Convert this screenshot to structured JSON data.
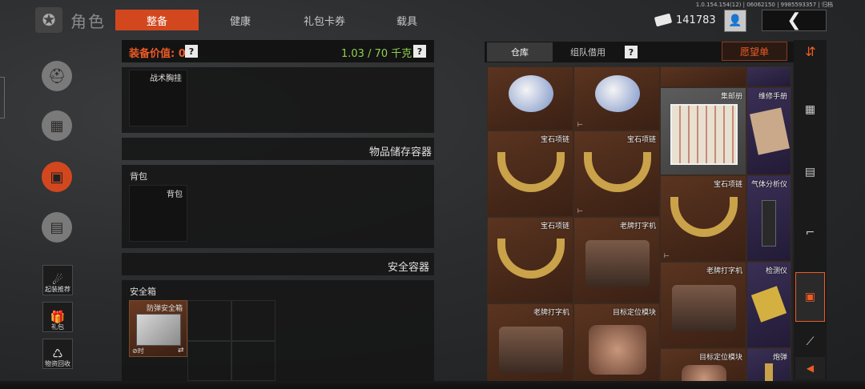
{
  "version": "1.0.154.154(12) | 06062150 | 9985593357 | 归档",
  "header": {
    "title": "角色",
    "tabs": [
      {
        "label": "整备",
        "active": true
      },
      {
        "label": "健康",
        "active": false
      },
      {
        "label": "礼包卡券",
        "active": false
      },
      {
        "label": "载具",
        "active": false
      }
    ],
    "currency": "141783",
    "back_icon": "❮"
  },
  "left_rail": {
    "labels": [
      "起装推荐",
      "礼包",
      "物资回收"
    ]
  },
  "equipment": {
    "value_label": "装备价值: 0",
    "weight": "1.03 / 70 千克",
    "help": "?",
    "vest_label": "战术胸挂",
    "storage_title": "物品储存容器",
    "backpack_section": "背包",
    "backpack_slot": "背包",
    "safe_title": "安全容器",
    "safe_section": "安全箱",
    "safe_item": "防弹安全箱",
    "safe_item_tag": "⊘时",
    "safe_item_swap": "⇄"
  },
  "inventory": {
    "tabs": [
      {
        "label": "仓库",
        "active": true
      },
      {
        "label": "组队借用",
        "active": false
      }
    ],
    "help": "?",
    "wishlist": "愿望单",
    "items": [
      {
        "name": "",
        "tag": "",
        "color": "brown"
      },
      {
        "name": "",
        "tag": "⊢",
        "color": "brown"
      },
      {
        "name": "集邮册",
        "tag": "",
        "color": "gray"
      },
      {
        "name": "维修手册",
        "tag": "",
        "color": "purple"
      },
      {
        "name": "宝石项链",
        "tag": "",
        "color": "brown"
      },
      {
        "name": "宝石项链",
        "tag": "⊢",
        "color": "brown"
      },
      {
        "name": "宝石项链",
        "tag": "⊢",
        "color": "brown"
      },
      {
        "name": "气体分析仪",
        "tag": "",
        "color": "purple"
      },
      {
        "name": "宝石项链",
        "tag": "",
        "color": "brown"
      },
      {
        "name": "老牌打字机",
        "tag": "",
        "color": "brown"
      },
      {
        "name": "老牌打字机",
        "tag": "",
        "color": "brown"
      },
      {
        "name": "检测仪",
        "tag": "",
        "color": "purple"
      },
      {
        "name": "老牌打字机",
        "tag": "",
        "color": "brown"
      },
      {
        "name": "目标定位模块",
        "tag": "",
        "color": "brown"
      },
      {
        "name": "目标定位模块",
        "tag": "",
        "color": "brown"
      },
      {
        "name": "炮弹",
        "tag": "",
        "color": "purple"
      }
    ]
  },
  "category_icons": [
    "sort-icon",
    "armor-icon",
    "vest-icon",
    "rifle-icon",
    "box-icon",
    "knife-icon"
  ]
}
